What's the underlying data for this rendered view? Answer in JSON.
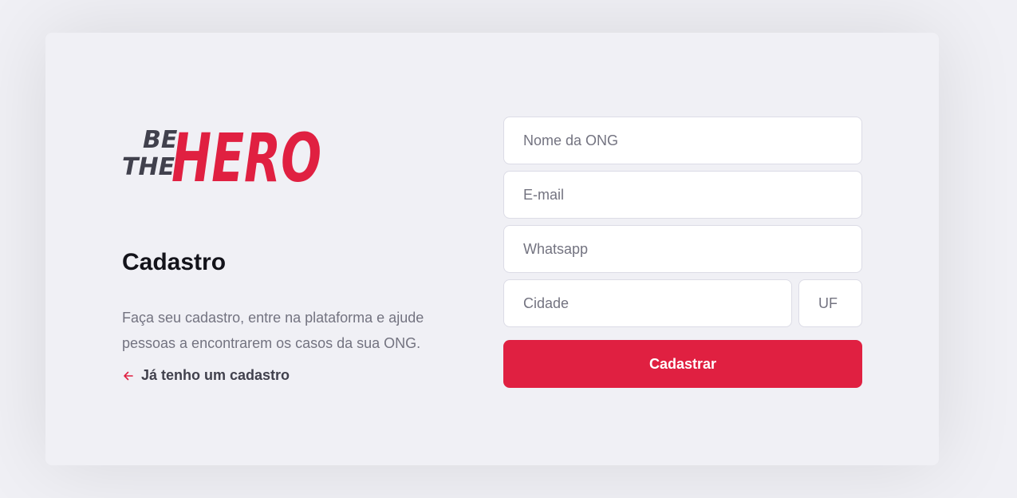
{
  "logo": {
    "line1": "BE",
    "line2": "THE",
    "word": "HERO",
    "alt_text": "Be The Hero"
  },
  "register": {
    "title": "Cadastro",
    "description": "Faça seu cadastro, entre na plataforma e ajude pessoas a encontrarem os casos da sua ONG.",
    "back_link": "Já tenho um cadastro"
  },
  "form": {
    "name_placeholder": "Nome da ONG",
    "email_placeholder": "E-mail",
    "whatsapp_placeholder": "Whatsapp",
    "city_placeholder": "Cidade",
    "uf_placeholder": "UF",
    "submit_label": "Cadastrar"
  },
  "colors": {
    "brand_red": "#e02041",
    "dark_text": "#41414d",
    "background": "#f0f0f5"
  }
}
